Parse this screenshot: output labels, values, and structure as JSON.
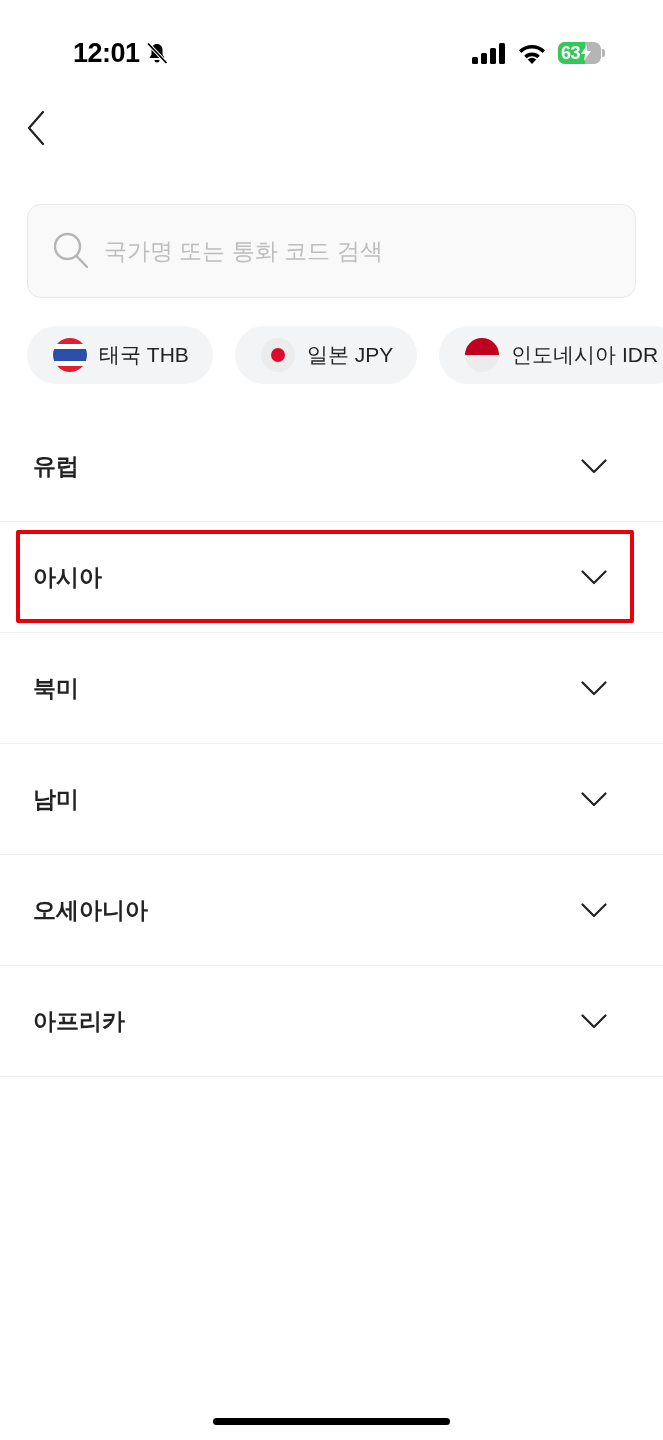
{
  "status_bar": {
    "time": "12:01",
    "silent": true,
    "battery": "63",
    "charging": true
  },
  "search": {
    "placeholder": "국가명 또는 통화 코드 검색"
  },
  "quick_currencies": [
    {
      "label": "태국 THB",
      "kind": "th"
    },
    {
      "label": "일본 JPY",
      "kind": "jp"
    },
    {
      "label": "인도네시아 IDR",
      "kind": "id"
    }
  ],
  "regions": [
    {
      "label": "유럽",
      "expanded": false,
      "highlighted": false
    },
    {
      "label": "아시아",
      "expanded": false,
      "highlighted": true
    },
    {
      "label": "북미",
      "expanded": false,
      "highlighted": false
    },
    {
      "label": "남미",
      "expanded": false,
      "highlighted": false
    },
    {
      "label": "오세아니아",
      "expanded": false,
      "highlighted": false
    },
    {
      "label": "아프리카",
      "expanded": false,
      "highlighted": false
    }
  ]
}
